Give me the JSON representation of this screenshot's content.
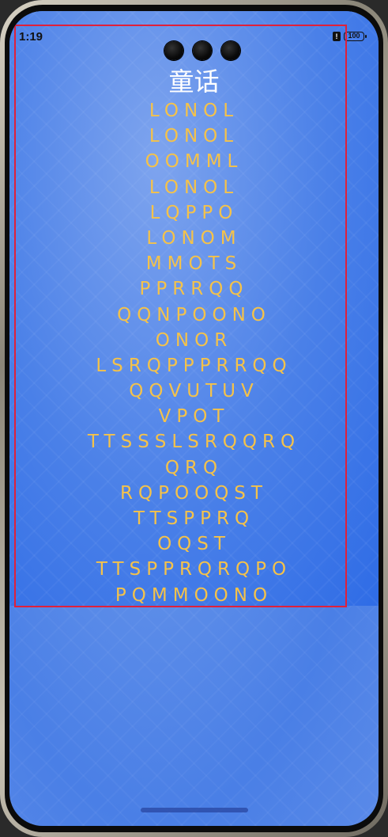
{
  "status_bar": {
    "time": "1:19",
    "alert_glyph": "!",
    "battery_label": "100"
  },
  "page": {
    "title": "童话",
    "lines": [
      "LONOL",
      "LONOL",
      "OOMML",
      "LONOL",
      "LQPPO",
      "LONOM",
      "MMOTS",
      "PPRRQQ",
      "QQNPOONO",
      "ONOR",
      "LSRQPPPRRQQ",
      "QQVUTUV",
      "VPOT",
      "TTSSSLSRQQRQ",
      "QRQ",
      "RQPOOQST",
      "TTSPPRQ",
      "OQST",
      "TTSPPRQRQPO",
      "PQMMOONO"
    ]
  },
  "colors": {
    "title": "#ffffff",
    "notes": "#f4c24a",
    "frame": "#e0203a",
    "background": "#4a80e8"
  },
  "icons": [
    "camera-icon",
    "alert-icon",
    "battery-icon"
  ]
}
